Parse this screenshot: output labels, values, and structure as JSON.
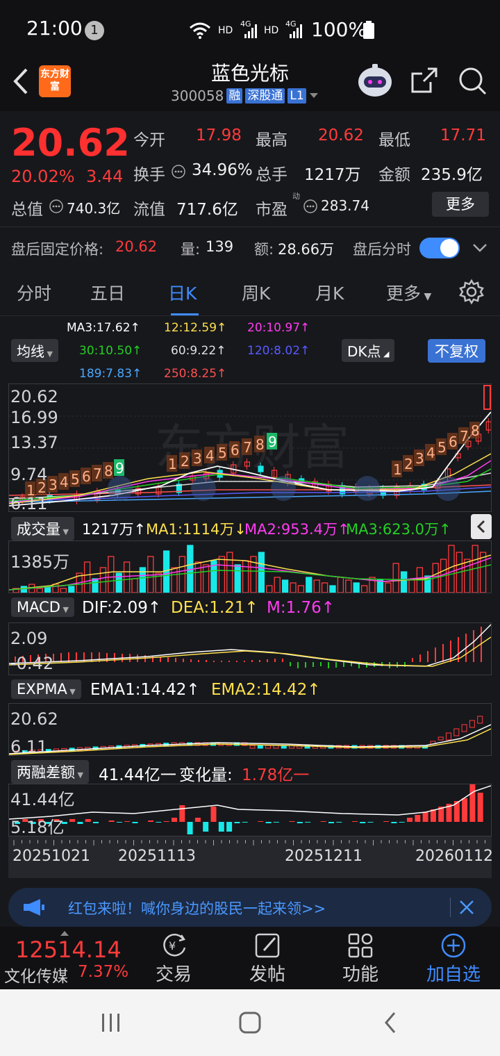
{
  "status_bar": {
    "time": "21:00",
    "notif_count": "1",
    "hd1": "HD",
    "net1": "4G",
    "hd2": "HD",
    "net2": "4G",
    "battery": "100%"
  },
  "header": {
    "title": "蓝色光标",
    "code": "300058",
    "tags": [
      "融",
      "深股通",
      "L1"
    ],
    "logo_text": "东方财富"
  },
  "quote": {
    "price": "20.62",
    "change_pct": "20.02%",
    "change": "3.44",
    "open_label": "今开",
    "open": "17.98",
    "high_label": "最高",
    "high": "20.62",
    "low_label": "最低",
    "low": "17.71",
    "turnover_label": "换手",
    "turnover": "34.96%",
    "volume_label": "总手",
    "volume": "1217万",
    "amount_label": "金额",
    "amount": "235.9亿",
    "mktcap_label": "总值",
    "mktcap": "740.3亿",
    "float_label": "流值",
    "float": "717.6亿",
    "pe_label": "市盈",
    "pe_sup": "动",
    "pe": "283.74",
    "more": "更多",
    "after_label": "盘后固定价格:",
    "after_price": "20.62",
    "after_vol_label": "量:",
    "after_vol": "139",
    "after_amt_label": "额:",
    "after_amt": "28.66万",
    "after_toggle_label": "盘后分时"
  },
  "tabs": [
    "分时",
    "五日",
    "日K",
    "周K",
    "月K",
    "更多"
  ],
  "active_tab": "日K",
  "ma_lines": {
    "ma3": "MA3:17.62↑",
    "ma12": "12:12.59↑",
    "ma20": "20:10.97↑",
    "ma30": "30:10.50↑",
    "ma60": "60:9.22↑",
    "ma120": "120:8.02↑",
    "ma189": "189:7.83↑",
    "ma250": "250:8.25↑"
  },
  "controls": {
    "junxian": "均线",
    "dk": "DK点",
    "fuquan": "不复权"
  },
  "kline_axis": [
    "20.62",
    "16.99",
    "13.37",
    "9.74",
    "6.11"
  ],
  "kline_numbers": [
    "1",
    "2",
    "3",
    "4",
    "5",
    "6",
    "7",
    "8",
    "9"
  ],
  "volume_panel": {
    "label": "成交量",
    "vol": "1217万↑",
    "ma1": "MA1:1114万↓",
    "ma2": "MA2:953.4万↑",
    "ma3": "MA3:623.0万↑",
    "axis": "1385万"
  },
  "macd_panel": {
    "label": "MACD",
    "dif": "DIF:2.09↑",
    "dea": "DEA:1.21↑",
    "m": "M:1.76↑",
    "axis_top": "2.09",
    "axis_bot": "-0.42"
  },
  "expma_panel": {
    "label": "EXPMA",
    "ema1": "EMA1:14.42↑",
    "ema2": "EMA2:14.42↑",
    "axis_top": "20.62",
    "axis_bot": "6.11"
  },
  "margin_panel": {
    "label": "两融差额",
    "val": "41.44亿一",
    "change_label": "变化量:",
    "change": "1.78亿一",
    "axis_top": "41.44亿",
    "axis_bot": "5.18亿"
  },
  "dates": [
    "20251021",
    "20251113",
    "20251211",
    "20260112"
  ],
  "banner": {
    "text": "红包来啦！喊你身边的股民一起来领>>"
  },
  "bottom": {
    "index_value": "12514.14",
    "index_name": "文化传媒",
    "index_change": "7.37%",
    "items": [
      "交易",
      "发帖",
      "功能",
      "加自选"
    ]
  },
  "colors": {
    "up": "#ff3b3b",
    "down": "#18e8e8",
    "accent": "#3f8cff",
    "ma_yellow": "#ffe14d",
    "ma_magenta": "#ff3cf0",
    "ma_green": "#24d024"
  }
}
